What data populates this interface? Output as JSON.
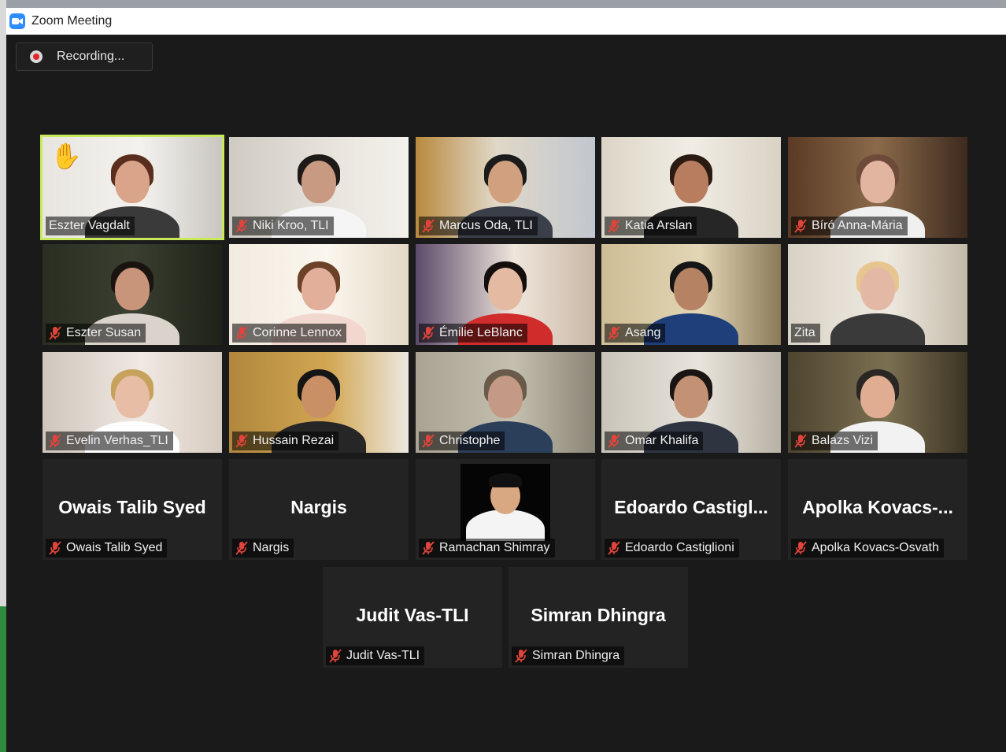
{
  "window": {
    "title": "Zoom Meeting",
    "recording_label": "Recording..."
  },
  "icons": {
    "app": "zoom-camera-icon",
    "recording": "record-dot-icon",
    "mute": "mic-muted-icon",
    "raised_hand": "raised-hand-icon"
  },
  "colors": {
    "active_speaker_border": "#c8ea5a",
    "muted_mic": "#e0443a",
    "meeting_background": "#1a1a1a",
    "zoom_blue": "#2d8cff"
  },
  "participants": [
    {
      "name": "Eszter Vagdalt",
      "video": true,
      "muted": false,
      "active_speaker": true,
      "hand_raised": true
    },
    {
      "name": "Niki Kroo, TLI",
      "video": true,
      "muted": true
    },
    {
      "name": "Marcus Oda, TLI",
      "video": true,
      "muted": true
    },
    {
      "name": "Katia Arslan",
      "video": true,
      "muted": true
    },
    {
      "name": "Bíró Anna-Mária",
      "video": true,
      "muted": true
    },
    {
      "name": "Eszter Susan",
      "video": true,
      "muted": true
    },
    {
      "name": "Corinne Lennox",
      "video": true,
      "muted": true
    },
    {
      "name": "Émilie LeBlanc",
      "video": true,
      "muted": true
    },
    {
      "name": "Asang",
      "video": true,
      "muted": true
    },
    {
      "name": "Zita",
      "video": true,
      "muted": false
    },
    {
      "name": "Evelin Verhas_TLI",
      "video": true,
      "muted": true
    },
    {
      "name": "Hussain Rezai",
      "video": true,
      "muted": true
    },
    {
      "name": "Christophe",
      "video": true,
      "muted": true
    },
    {
      "name": "Omar Khalifa",
      "video": true,
      "muted": true
    },
    {
      "name": "Balazs Vizi",
      "video": true,
      "muted": true
    },
    {
      "name": "Owais Talib Syed",
      "display_name": "Owais Talib Syed",
      "video": false,
      "muted": true
    },
    {
      "name": "Nargis",
      "display_name": "Nargis",
      "video": false,
      "muted": true
    },
    {
      "name": "Ramachan Shimray",
      "video": false,
      "profile_photo": true,
      "muted": true
    },
    {
      "name": "Edoardo Castiglioni",
      "display_name": "Edoardo  Castigl...",
      "video": false,
      "muted": true
    },
    {
      "name": "Apolka Kovacs-Osvath",
      "display_name": "Apolka  Kovacs-...",
      "video": false,
      "muted": true
    },
    {
      "name": "Judit Vas-TLI",
      "display_name": "Judit Vas-TLI",
      "video": false,
      "muted": true
    },
    {
      "name": "Simran Dhingra",
      "display_name": "Simran Dhingra",
      "video": false,
      "muted": true
    }
  ]
}
